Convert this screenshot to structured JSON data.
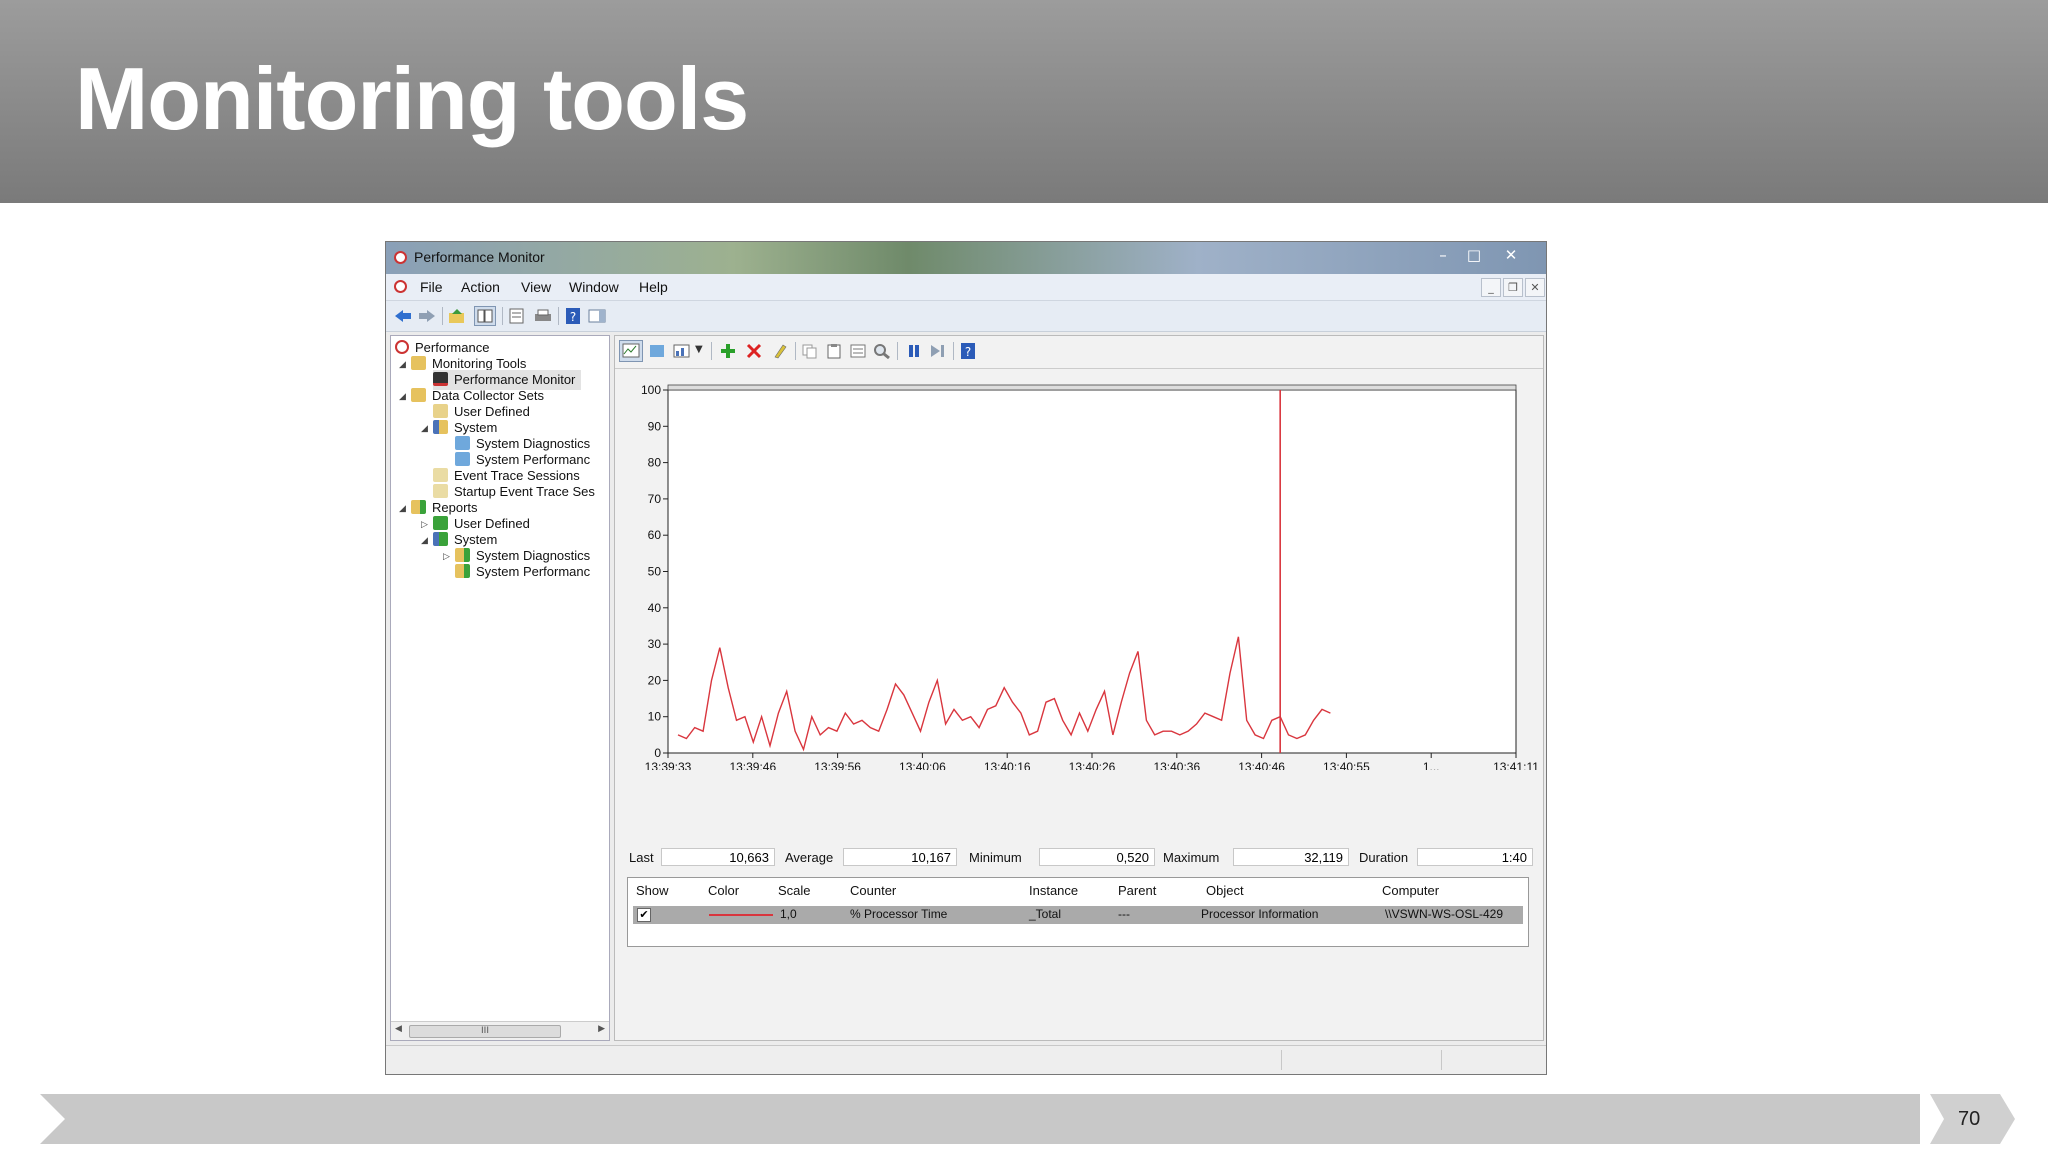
{
  "slide": {
    "title": "Monitoring tools",
    "page_number": "70"
  },
  "window": {
    "title": "Performance Monitor",
    "menu": [
      "File",
      "Action",
      "View",
      "Window",
      "Help"
    ],
    "controls": {
      "minimize": "–",
      "maximize": "□",
      "close": "✕"
    }
  },
  "tree": {
    "items": [
      {
        "label": "Performance"
      },
      {
        "label": "Monitoring Tools"
      },
      {
        "label": "Performance Monitor"
      },
      {
        "label": "Data Collector Sets"
      },
      {
        "label": "User Defined"
      },
      {
        "label": "System"
      },
      {
        "label": "System Diagnostics"
      },
      {
        "label": "System Performanc"
      },
      {
        "label": "Event Trace Sessions"
      },
      {
        "label": "Startup Event Trace Ses"
      },
      {
        "label": "Reports"
      },
      {
        "label": "User Defined"
      },
      {
        "label": "System"
      },
      {
        "label": "System Diagnostics"
      },
      {
        "label": "System Performanc"
      }
    ],
    "scroll_thumb": "III"
  },
  "stats": {
    "last_label": "Last",
    "last": "10,663",
    "average_label": "Average",
    "average": "10,167",
    "minimum_label": "Minimum",
    "minimum": "0,520",
    "maximum_label": "Maximum",
    "maximum": "32,119",
    "duration_label": "Duration",
    "duration": "1:40"
  },
  "legend": {
    "headers": [
      "Show",
      "Color",
      "Scale",
      "Counter",
      "Instance",
      "Parent",
      "Object",
      "Computer"
    ],
    "row": {
      "check": "✔",
      "scale": "1,0",
      "counter": "% Processor Time",
      "instance": "_Total",
      "parent": "---",
      "object": "Processor Information",
      "computer": "\\\\VSWN-WS-OSL-429",
      "color": "#d9363e"
    }
  },
  "chart_data": {
    "type": "line",
    "ylim": [
      0,
      100
    ],
    "yticks": [
      0,
      10,
      20,
      30,
      40,
      50,
      60,
      70,
      80,
      90,
      100
    ],
    "xticks": [
      "13:39:33",
      "13:39:46",
      "13:39:56",
      "13:40:06",
      "13:40:16",
      "13:40:26",
      "13:40:36",
      "13:40:46",
      "13:40:55",
      "1...",
      "13:41:11"
    ],
    "cursor_sample": 72,
    "series": [
      {
        "values": [
          5,
          4,
          7,
          6,
          20,
          29,
          18,
          9,
          10,
          3,
          10,
          2,
          11,
          17,
          6,
          1,
          10,
          5,
          7,
          6,
          11,
          8,
          9,
          7,
          6,
          12,
          19,
          16,
          11,
          6,
          14,
          20,
          8,
          12,
          9,
          10,
          7,
          12,
          13,
          18,
          14,
          11,
          5,
          6,
          14,
          15,
          9,
          5,
          11,
          6,
          12,
          17,
          5,
          14,
          22,
          28,
          9,
          5,
          6,
          6,
          5,
          6,
          8,
          11,
          10,
          9,
          22,
          32,
          9,
          5,
          4,
          9,
          10,
          5,
          4,
          5,
          9,
          12,
          11
        ]
      }
    ],
    "line_color": "#d9363e"
  }
}
